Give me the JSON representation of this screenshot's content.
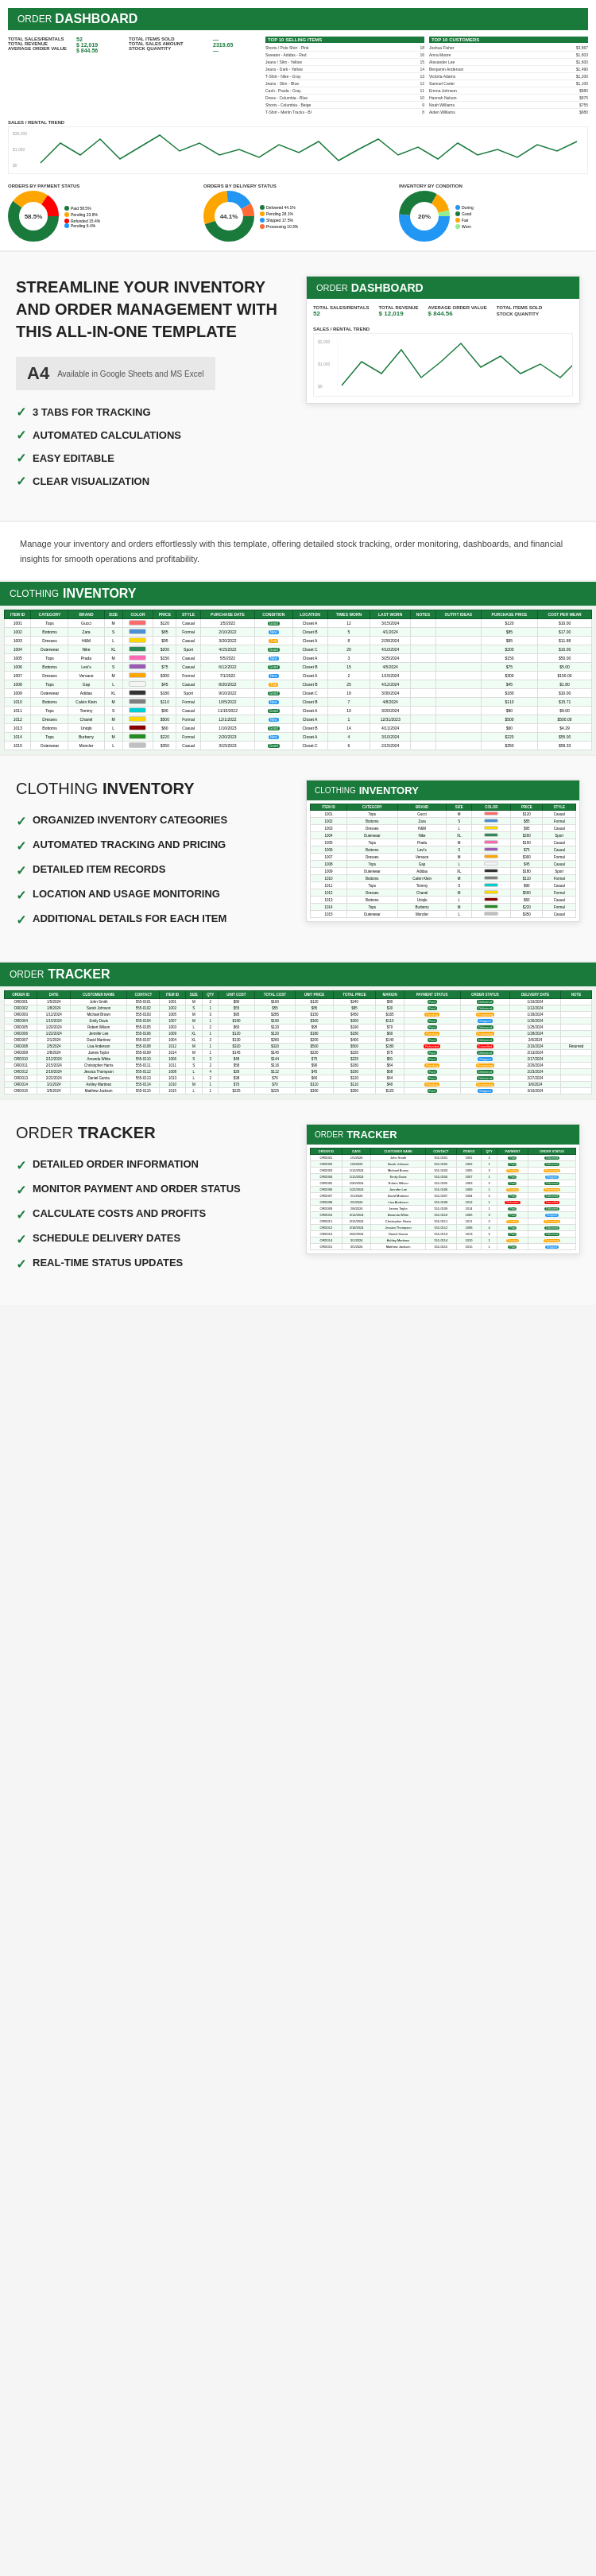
{
  "dashboard": {
    "title": {
      "order": "ORDER",
      "dashboard": "DASHBOARD"
    },
    "stats": {
      "sales_rentals_label": "TOTAL SALES/RENTALS",
      "sales_rentals_value": "52",
      "revenue_label": "TOTAL REVENUE",
      "revenue_value": "$ 12,019",
      "avg_order_label": "AVERAGE ORDER VALUE",
      "avg_order_value": "$ 844.56",
      "items_sold_label": "TOTAL ITEMS SOLD",
      "items_sold_value": "",
      "sales_amount_label": "TOTAL SALES AMOUNT",
      "sales_amount_value": "2319.65",
      "stock_qty_label": "STOCK QUANTITY",
      "stock_qty_value": ""
    },
    "top_selling_title": "TOP 10 SELLING ITEMS",
    "top_customers_title": "TOP 10 CUSTOMERS",
    "trend_title": "SALES / RENTAL TREND",
    "payment_status_title": "ORDERS BY PAYMENT STATUS",
    "delivery_status_title": "ORDERS BY DELIVERY STATUS",
    "inventory_condition_title": "INVENTORY BY CONDITION"
  },
  "marketing": {
    "headline": "STREAMLINE YOUR INVENTORY AND ORDER MANAGEMENT WITH THIS ALL-IN-ONE TEMPLATE",
    "badge_size": "A4",
    "badge_subtitle": "Available in Google Sheets and MS Excel",
    "features": [
      "3 TABS FOR TRACKING",
      "AUTOMATED CALCULATIONS",
      "EASY EDITABLE",
      "CLEAR VISUALIZATION"
    ]
  },
  "description": {
    "text": "Manage your inventory and orders effortlessly with this template, offering detailed stock tracking, order monitoring, dashboards, and financial insights for smooth operations and profitability."
  },
  "clothing_inventory": {
    "title": {
      "order": "CLOTHING",
      "dashboard": "INVENTORY"
    },
    "features": [
      "ORGANIZED INVENTORY CATEGORIES",
      "AUTOMATED TRACKING AND PRICING",
      "DETAILED ITEM RECORDS",
      "LOCATION AND USAGE MONITORING",
      "ADDITIONAL DETAILS FOR EACH ITEM"
    ],
    "columns": [
      "ITEM ID",
      "CATEGORY",
      "BRAND",
      "SIZE",
      "COLOR",
      "PRICE",
      "STYLE",
      "PURCHASE DATE",
      "CONDITION",
      "LOCATION",
      "TIMES WORN",
      "LAST WORN",
      "NOTES",
      "OUTFIT IDEAS",
      "PURCHASE PRICE",
      "COST PER WEAR"
    ],
    "rows": [
      [
        "1001",
        "Tops",
        "Gucci",
        "M",
        "",
        "$120",
        "Casual",
        "1/5/2022",
        "Good",
        "Closet A",
        "12",
        "3/15/2024",
        "",
        "",
        "$120",
        "$10.00"
      ],
      [
        "1002",
        "Bottoms",
        "Zara",
        "S",
        "",
        "$85",
        "Formal",
        "2/10/2022",
        "New",
        "Closet B",
        "5",
        "4/1/2024",
        "",
        "",
        "$85",
        "$17.00"
      ],
      [
        "1003",
        "Dresses",
        "H&M",
        "L",
        "",
        "$95",
        "Casual",
        "3/20/2022",
        "Fair",
        "Closet A",
        "8",
        "2/28/2024",
        "",
        "",
        "$95",
        "$11.88"
      ],
      [
        "1004",
        "Outerwear",
        "Nike",
        "XL",
        "",
        "$200",
        "Sport",
        "4/15/2022",
        "Good",
        "Closet C",
        "20",
        "4/10/2024",
        "",
        "",
        "$200",
        "$10.00"
      ],
      [
        "1005",
        "Tops",
        "Prada",
        "M",
        "",
        "$150",
        "Casual",
        "5/5/2022",
        "New",
        "Closet A",
        "3",
        "3/25/2024",
        "",
        "",
        "$150",
        "$50.00"
      ],
      [
        "1006",
        "Bottoms",
        "Levi's",
        "S",
        "",
        "$75",
        "Casual",
        "6/12/2022",
        "Good",
        "Closet B",
        "15",
        "4/5/2024",
        "",
        "",
        "$75",
        "$5.00"
      ],
      [
        "1007",
        "Dresses",
        "Versace",
        "M",
        "",
        "$300",
        "Formal",
        "7/1/2022",
        "New",
        "Closet A",
        "2",
        "1/15/2024",
        "",
        "",
        "$300",
        "$150.00"
      ],
      [
        "1008",
        "Tops",
        "Gap",
        "L",
        "",
        "$45",
        "Casual",
        "8/20/2022",
        "Fair",
        "Closet B",
        "25",
        "4/12/2024",
        "",
        "",
        "$45",
        "$1.80"
      ],
      [
        "1009",
        "Outerwear",
        "Adidas",
        "XL",
        "",
        "$180",
        "Sport",
        "9/10/2022",
        "Good",
        "Closet C",
        "18",
        "3/30/2024",
        "",
        "",
        "$180",
        "$10.00"
      ],
      [
        "1010",
        "Bottoms",
        "Calvin Klein",
        "M",
        "",
        "$110",
        "Formal",
        "10/5/2022",
        "New",
        "Closet B",
        "7",
        "4/8/2024",
        "",
        "",
        "$110",
        "$15.71"
      ],
      [
        "1011",
        "Tops",
        "Tommy",
        "S",
        "",
        "$90",
        "Casual",
        "11/15/2022",
        "Good",
        "Closet A",
        "10",
        "3/20/2024",
        "",
        "",
        "$90",
        "$9.00"
      ],
      [
        "1012",
        "Dresses",
        "Chanel",
        "M",
        "",
        "$500",
        "Formal",
        "12/1/2022",
        "New",
        "Closet A",
        "1",
        "12/31/2023",
        "",
        "",
        "$500",
        "$500.00"
      ],
      [
        "1013",
        "Bottoms",
        "Uniqlo",
        "L",
        "",
        "$60",
        "Casual",
        "1/10/2023",
        "Good",
        "Closet B",
        "14",
        "4/11/2024",
        "",
        "",
        "$60",
        "$4.29"
      ],
      [
        "1014",
        "Tops",
        "Burberry",
        "M",
        "",
        "$220",
        "Formal",
        "2/20/2023",
        "New",
        "Closet A",
        "4",
        "3/10/2024",
        "",
        "",
        "$220",
        "$55.00"
      ],
      [
        "1015",
        "Outerwear",
        "Moncler",
        "L",
        "",
        "$350",
        "Casual",
        "3/15/2023",
        "Good",
        "Closet C",
        "6",
        "2/15/2024",
        "",
        "",
        "$350",
        "$58.33"
      ]
    ],
    "colors": [
      "#FF0000",
      "#0000FF",
      "#FFFF00",
      "#008000",
      "#FF69B4",
      "#800080",
      "#FFA500",
      "#FFFFFF",
      "#000000",
      "#808080",
      "#00FFFF",
      "#FFD700",
      "#8B0000",
      "#006400",
      "#C0C0C0"
    ]
  },
  "order_tracker": {
    "title": {
      "order": "ORDER",
      "tracker": "TRACKER"
    },
    "features": [
      "DETAILED ORDER INFORMATION",
      "MONITOR PAYMENT AND ORDER STATUS",
      "CALCULATE COSTS AND PROFITS",
      "SCHEDULE DELIVERY DATES",
      "REAL-TIME STATUS UPDATES"
    ],
    "columns": [
      "ORDER ID",
      "DATE",
      "CUSTOMER NAME",
      "CONTACT",
      "ITEM ID",
      "SIZE",
      "QTY",
      "UNIT COST",
      "TOTAL COST",
      "UNIT PRICE",
      "TOTAL PRICE",
      "MARGIN",
      "PAYMENT STATUS",
      "ORDER STATUS",
      "DELIVERY DATE",
      "NOTE"
    ],
    "rows": [
      [
        "ORD001",
        "1/5/2024",
        "John Smith",
        "555-0101",
        "1001",
        "M",
        "2",
        "$80",
        "$160",
        "$120",
        "$240",
        "$80",
        "Paid",
        "Delivered",
        "1/10/2024",
        ""
      ],
      [
        "ORD002",
        "1/8/2024",
        "Sarah Johnson",
        "555-0102",
        "1002",
        "S",
        "1",
        "$55",
        "$55",
        "$85",
        "$85",
        "$30",
        "Paid",
        "Delivered",
        "1/12/2024",
        ""
      ],
      [
        "ORD003",
        "1/12/2024",
        "Michael Brown",
        "555-0103",
        "1005",
        "M",
        "3",
        "$95",
        "$285",
        "$150",
        "$450",
        "$165",
        "Pending",
        "Processing",
        "1/18/2024",
        ""
      ],
      [
        "ORD004",
        "1/15/2024",
        "Emily Davis",
        "555-0104",
        "1007",
        "M",
        "1",
        "$190",
        "$190",
        "$300",
        "$300",
        "$110",
        "Paid",
        "Shipped",
        "1/20/2024",
        ""
      ],
      [
        "ORD005",
        "1/20/2024",
        "Robert Wilson",
        "555-0105",
        "1003",
        "L",
        "2",
        "$60",
        "$120",
        "$95",
        "$190",
        "$70",
        "Paid",
        "Delivered",
        "1/25/2024",
        ""
      ],
      [
        "ORD006",
        "1/22/2024",
        "Jennifer Lee",
        "555-0106",
        "1009",
        "XL",
        "1",
        "$120",
        "$120",
        "$180",
        "$180",
        "$60",
        "Pending",
        "Processing",
        "1/28/2024",
        ""
      ],
      [
        "ORD007",
        "2/1/2024",
        "David Martinez",
        "555-0107",
        "1004",
        "XL",
        "2",
        "$130",
        "$260",
        "$200",
        "$400",
        "$140",
        "Paid",
        "Delivered",
        "2/6/2024",
        ""
      ],
      [
        "ORD008",
        "2/5/2024",
        "Lisa Anderson",
        "555-0108",
        "1012",
        "M",
        "1",
        "$320",
        "$320",
        "$500",
        "$500",
        "$180",
        "Refunded",
        "Cancelled",
        "2/10/2024",
        "Returned"
      ],
      [
        "ORD009",
        "2/8/2024",
        "James Taylor",
        "555-0109",
        "1014",
        "M",
        "1",
        "$145",
        "$145",
        "$220",
        "$220",
        "$75",
        "Paid",
        "Delivered",
        "2/13/2024",
        ""
      ],
      [
        "ORD010",
        "2/12/2024",
        "Amanda White",
        "555-0110",
        "1006",
        "S",
        "3",
        "$48",
        "$144",
        "$75",
        "$225",
        "$81",
        "Paid",
        "Shipped",
        "2/17/2024",
        ""
      ],
      [
        "ORD011",
        "2/15/2024",
        "Christopher Harris",
        "555-0111",
        "1011",
        "S",
        "2",
        "$58",
        "$116",
        "$90",
        "$180",
        "$64",
        "Pending",
        "Processing",
        "2/20/2024",
        ""
      ],
      [
        "ORD012",
        "2/18/2024",
        "Jessica Thompson",
        "555-0112",
        "1008",
        "L",
        "4",
        "$28",
        "$112",
        "$45",
        "$180",
        "$68",
        "Paid",
        "Delivered",
        "2/23/2024",
        ""
      ],
      [
        "ORD013",
        "2/22/2024",
        "Daniel Garcia",
        "555-0113",
        "1013",
        "L",
        "2",
        "$38",
        "$76",
        "$60",
        "$120",
        "$44",
        "Paid",
        "Delivered",
        "2/27/2024",
        ""
      ],
      [
        "ORD014",
        "3/1/2024",
        "Ashley Martinez",
        "555-0114",
        "1010",
        "M",
        "1",
        "$70",
        "$70",
        "$110",
        "$110",
        "$40",
        "Pending",
        "Processing",
        "3/6/2024",
        ""
      ],
      [
        "ORD015",
        "3/5/2024",
        "Matthew Jackson",
        "555-0115",
        "1015",
        "L",
        "1",
        "$225",
        "$225",
        "$350",
        "$350",
        "$125",
        "Paid",
        "Shipped",
        "3/10/2024",
        ""
      ]
    ]
  },
  "payment_statuses": {
    "paid": {
      "label": "Paid",
      "color": "#1a7a3c"
    },
    "pending": {
      "label": "Pending",
      "color": "#FFA500"
    },
    "refunded": {
      "label": "Refunded",
      "color": "#FF0000"
    }
  },
  "order_statuses": {
    "delivered": {
      "label": "Delivered",
      "color": "#1a7a3c"
    },
    "shipped": {
      "label": "Shipped",
      "color": "#2196F3"
    },
    "processing": {
      "label": "Processing",
      "color": "#FFA500"
    },
    "cancelled": {
      "label": "Cancelled",
      "color": "#FF0000"
    }
  }
}
